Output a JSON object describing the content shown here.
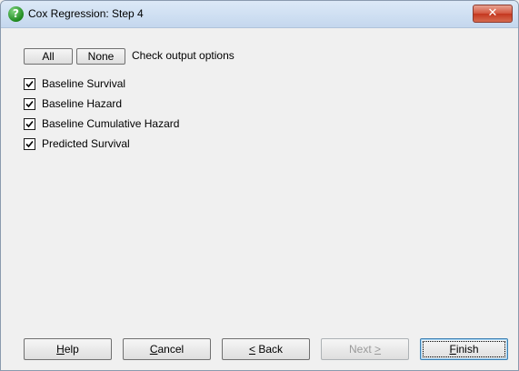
{
  "window": {
    "title": "Cox Regression: Step 4",
    "close_glyph": "✕",
    "app_icon_glyph": "?"
  },
  "options": {
    "all_label": "All",
    "none_label": "None",
    "caption": "Check output options",
    "items": [
      {
        "label": "Baseline Survival",
        "checked": true
      },
      {
        "label": "Baseline Hazard",
        "checked": true
      },
      {
        "label": "Baseline Cumulative Hazard",
        "checked": true
      },
      {
        "label": "Predicted Survival",
        "checked": true
      }
    ]
  },
  "footer": {
    "help": {
      "pre": "",
      "key": "H",
      "post": "elp"
    },
    "cancel": {
      "pre": "",
      "key": "C",
      "post": "ancel"
    },
    "back": {
      "pre": "",
      "key": "<",
      "post": " Back"
    },
    "next": {
      "pre": "Next ",
      "key": ">",
      "post": ""
    },
    "finish": {
      "pre": "",
      "key": "F",
      "post": "inish"
    }
  }
}
